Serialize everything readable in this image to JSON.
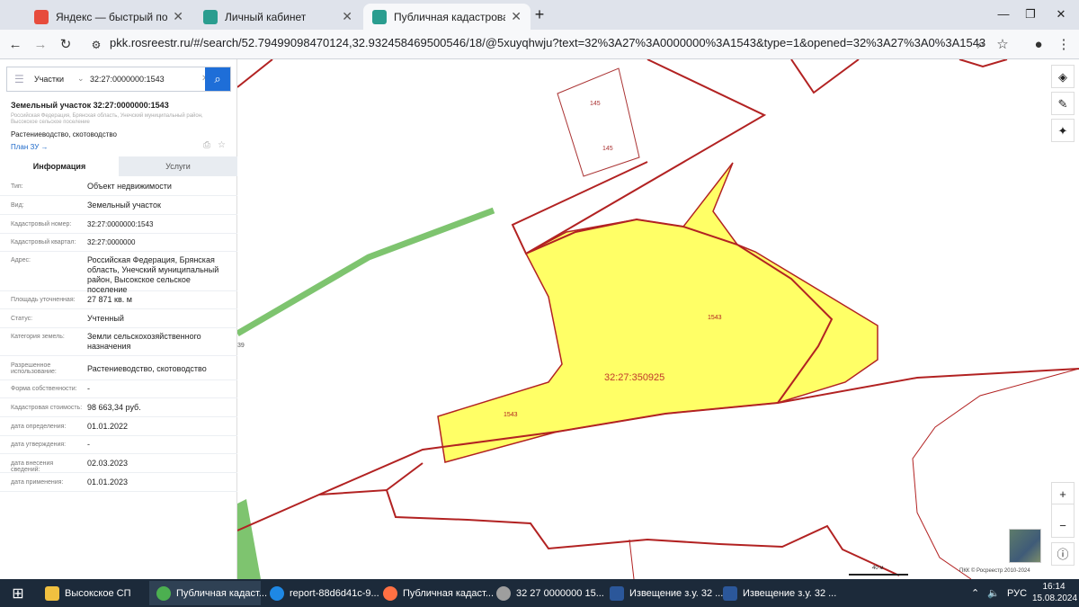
{
  "browser": {
    "tabs": [
      {
        "title": "Яндекс — быстрый поиск в и",
        "icon_color": "#e74c3c"
      },
      {
        "title": "Личный кабинет",
        "icon_color": "#2a9d8f"
      },
      {
        "title": "Публичная кадастровая карта",
        "icon_color": "#2a9d8f"
      }
    ],
    "url": "pkk.rosreestr.ru/#/search/52.79499098470124,32.932458469500546/18/@5xuyqhwju?text=32%3A27%3A0000000%3A1543&type=1&opened=32%3A27%3A0%3A1543"
  },
  "panel": {
    "search": {
      "layer": "Участки",
      "value": "32:27:0000000:1543"
    },
    "title": "Земельный участок 32:27:0000000:1543",
    "address_small": "Российская Федерация, Брянская область, Унечский муниципальный район, Высокское сельское поселение",
    "usage": "Растениеводство, скотоводство",
    "plan_link": "План ЗУ →",
    "tabs": [
      "Информация",
      "Услуги"
    ],
    "rows": [
      {
        "k": "Тип:",
        "v": "Объект недвижимости"
      },
      {
        "k": "Вид:",
        "v": "Земельный участок"
      },
      {
        "k": "Кадастровый номер:",
        "v": "32:27:0000000:1543"
      },
      {
        "k": "Кадастровый квартал:",
        "v": "32:27:0000000"
      },
      {
        "k": "Адрес:",
        "v": "Российская Федерация, Брянская область, Унечский муниципальный район, Высокское сельское поселение"
      },
      {
        "k": "Площадь уточненная:",
        "v": "27 871 кв. м"
      },
      {
        "k": "Статус:",
        "v": "Учтенный"
      },
      {
        "k": "Категория земель:",
        "v": "Земли сельскохозяйственного назначения"
      },
      {
        "k": "Разрешенное использование:",
        "v": "Растениеводство, скотоводство"
      },
      {
        "k": "Форма собственности:",
        "v": "-"
      },
      {
        "k": "Кадастровая стоимость:",
        "v": "98 663,34 руб."
      },
      {
        "k": "дата определения:",
        "v": "01.01.2022"
      },
      {
        "k": "дата утверждения:",
        "v": "-"
      },
      {
        "k": "дата внесения сведений:",
        "v": "02.03.2023"
      },
      {
        "k": "дата применения:",
        "v": "01.01.2023"
      }
    ]
  },
  "map": {
    "labels": {
      "main": "32:27:350925",
      "parcel_a": "1543",
      "parcel_b": "1543",
      "lot_145_a": "145",
      "lot_145_b": "145",
      "edge": "39"
    },
    "scale": "40 м",
    "attribution": "ПКК © Росреестр 2010-2024",
    "colors": {
      "parcel_fill": "#ffff66",
      "boundary": "#b22222",
      "road": "#7ec46f"
    }
  },
  "taskbar": {
    "items": [
      {
        "label": "Высокское СП",
        "color": "#f0c040"
      },
      {
        "label": "Публичная кадаст...",
        "color": "#4caf50"
      },
      {
        "label": "report-88d6d41c-9...",
        "color": "#1e88e5"
      },
      {
        "label": "Публичная кадаст...",
        "color": "#ff7043"
      },
      {
        "label": "32 27 0000000 15...",
        "color": "#9e9e9e"
      },
      {
        "label": "Извещение з.у. 32 ...",
        "color": "#2b579a"
      },
      {
        "label": "Извещение з.у. 32 ...",
        "color": "#2b579a"
      }
    ],
    "lang": "РУС",
    "time": "16:14",
    "date": "15.08.2024"
  }
}
